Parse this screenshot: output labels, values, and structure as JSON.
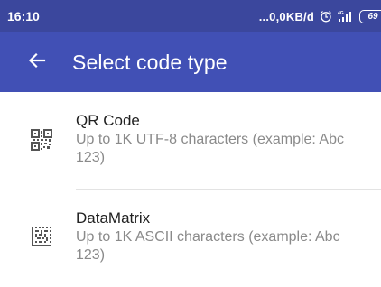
{
  "status_bar": {
    "time": "16:10",
    "network_speed": "...0,0KB/d",
    "icons": [
      "alarm-icon",
      "signal-icon",
      "battery-icon"
    ],
    "battery_level": "69",
    "background": "#3b479d"
  },
  "app_bar": {
    "title": "Select code type",
    "back_icon": "arrow-left-icon",
    "background": "#4150b5"
  },
  "code_types": [
    {
      "title": "QR Code",
      "description": "Up to 1K UTF-8 characters (example: Abc 123)",
      "icon": "qr-code-icon"
    },
    {
      "title": "DataMatrix",
      "description": "Up to 1K ASCII characters (example: Abc 123)",
      "icon": "datamatrix-icon"
    }
  ]
}
